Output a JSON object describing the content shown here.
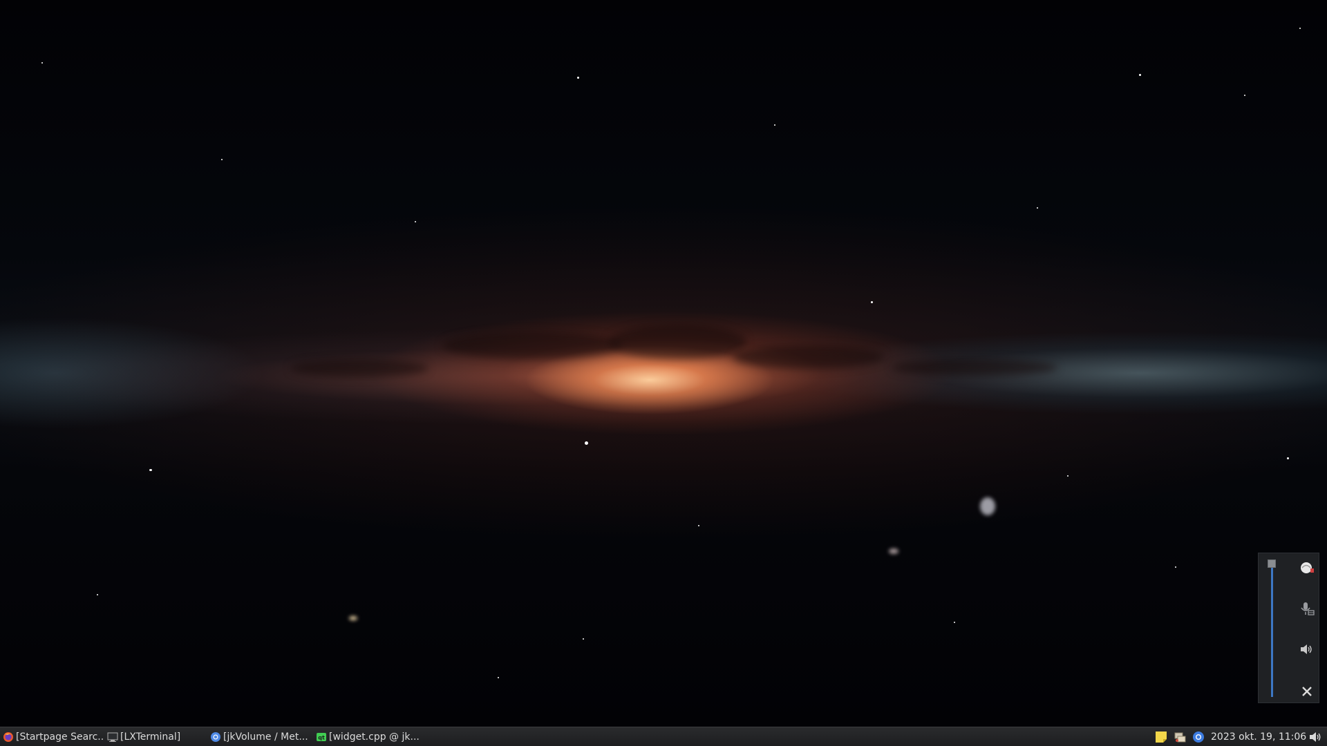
{
  "wallpaper": {
    "name": "milky-way-galaxy"
  },
  "volume_popup": {
    "volume_percent": 100,
    "buttons": [
      {
        "icon": "mixer-icon"
      },
      {
        "icon": "microphone-icon"
      },
      {
        "icon": "speaker-icon"
      },
      {
        "icon": "close-icon"
      }
    ]
  },
  "taskbar": {
    "tasks": [
      {
        "icon": "firefox-icon",
        "label": "[Startpage Searc..."
      },
      {
        "icon": "terminal-icon",
        "label": "[LXTerminal]"
      },
      {
        "icon": "chromium-icon",
        "label": "[jkVolume / Met..."
      },
      {
        "icon": "qtcreator-icon",
        "label": "[widget.cpp @ jk..."
      }
    ],
    "tray": [
      {
        "icon": "sticky-note-icon"
      },
      {
        "icon": "network-manager-icon"
      },
      {
        "icon": "chromium-tray-icon"
      }
    ],
    "clock": "2023 okt. 19, 11:06",
    "volume_tray_icon": "volume-icon"
  },
  "colors": {
    "slider_accent": "#3d77c4",
    "taskbar_bg": "#1d1e20",
    "popup_bg": "#1f2124"
  }
}
